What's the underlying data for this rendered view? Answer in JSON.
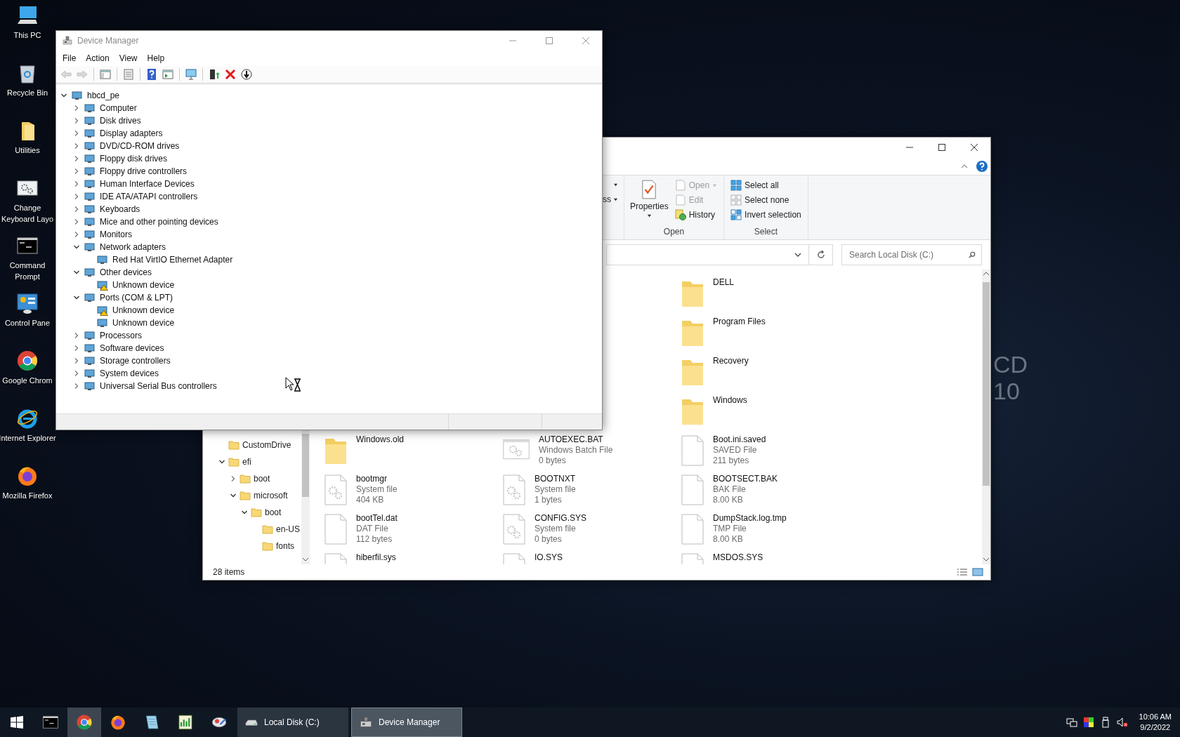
{
  "desktop": {
    "icons": [
      {
        "kind": "pc",
        "lines": [
          "This PC"
        ]
      },
      {
        "kind": "bin",
        "lines": [
          "Recycle Bin"
        ]
      },
      {
        "kind": "folder",
        "lines": [
          "Utilities"
        ]
      },
      {
        "kind": "gears",
        "lines": [
          "Change",
          "Keyboard Layo"
        ]
      },
      {
        "kind": "terminal",
        "lines": [
          "Command",
          "Prompt"
        ]
      },
      {
        "kind": "panel",
        "lines": [
          "Control Pane"
        ]
      },
      {
        "kind": "chrome",
        "lines": [
          "Google Chrom"
        ]
      },
      {
        "kind": "ie",
        "lines": [
          "Internet Explorer"
        ]
      },
      {
        "kind": "firefox",
        "lines": [
          "Mozilla Firefox"
        ]
      }
    ],
    "wallpaper_text": [
      "CD",
      "10"
    ]
  },
  "device_manager": {
    "title": "Device Manager",
    "menu": [
      "File",
      "Action",
      "View",
      "Help"
    ],
    "toolbar": [
      {
        "kind": "back",
        "disabled": true
      },
      {
        "kind": "forward",
        "disabled": true
      },
      {
        "kind": "separator"
      },
      {
        "kind": "tree-view",
        "disabled": false
      },
      {
        "kind": "separator"
      },
      {
        "kind": "properties",
        "disabled": false
      },
      {
        "kind": "separator"
      },
      {
        "kind": "help",
        "disabled": false
      },
      {
        "kind": "action-pane",
        "disabled": false
      },
      {
        "kind": "separator"
      },
      {
        "kind": "scan",
        "disabled": false
      },
      {
        "kind": "separator"
      },
      {
        "kind": "update",
        "disabled": false
      },
      {
        "kind": "uninstall",
        "disabled": false
      },
      {
        "kind": "download",
        "disabled": false
      }
    ],
    "tree": [
      {
        "label": "hbcd_pe",
        "expanded": true,
        "children": [
          {
            "label": "Computer",
            "expanded": false
          },
          {
            "label": "Disk drives",
            "expanded": false
          },
          {
            "label": "Display adapters",
            "expanded": false
          },
          {
            "label": "DVD/CD-ROM drives",
            "expanded": false
          },
          {
            "label": "Floppy disk drives",
            "expanded": false
          },
          {
            "label": "Floppy drive controllers",
            "expanded": false
          },
          {
            "label": "Human Interface Devices",
            "expanded": false
          },
          {
            "label": "IDE ATA/ATAPI controllers",
            "expanded": false
          },
          {
            "label": "Keyboards",
            "expanded": false
          },
          {
            "label": "Mice and other pointing devices",
            "expanded": false
          },
          {
            "label": "Monitors",
            "expanded": false
          },
          {
            "label": "Network adapters",
            "expanded": true,
            "children": [
              {
                "label": "Red Hat VirtIO Ethernet Adapter",
                "problem": false
              }
            ]
          },
          {
            "label": "Other devices",
            "expanded": true,
            "children": [
              {
                "label": "Unknown device",
                "problem": true
              }
            ]
          },
          {
            "label": "Ports (COM & LPT)",
            "expanded": true,
            "children": [
              {
                "label": "Unknown device",
                "problem": true
              },
              {
                "label": "Unknown device",
                "problem": false
              }
            ]
          },
          {
            "label": "Processors",
            "expanded": false
          },
          {
            "label": "Software devices",
            "expanded": false
          },
          {
            "label": "Storage controllers",
            "expanded": false
          },
          {
            "label": "System devices",
            "expanded": false
          },
          {
            "label": "Universal Serial Bus controllers",
            "expanded": false
          }
        ]
      }
    ]
  },
  "explorer": {
    "ribbon": {
      "partial_label": "ss",
      "properties_label": "Properties",
      "open_group": {
        "label": "Open",
        "items": [
          {
            "label": "Open",
            "disabled": true,
            "dropdown": true
          },
          {
            "label": "Edit",
            "disabled": true,
            "dropdown": false
          },
          {
            "label": "History",
            "disabled": false,
            "dropdown": false
          }
        ]
      },
      "select_group": {
        "label": "Select",
        "items": [
          {
            "label": "Select all"
          },
          {
            "label": "Select none"
          },
          {
            "label": "Invert selection"
          }
        ]
      }
    },
    "search": {
      "placeholder": "Search Local Disk (C:)"
    },
    "nav_tree": [
      {
        "label": "CustomDrive"
      },
      {
        "label": "efi",
        "expanded": true,
        "children": [
          {
            "label": "boot",
            "expanded": false
          },
          {
            "label": "microsoft",
            "expanded": true,
            "children": [
              {
                "label": "boot",
                "expanded": true,
                "children": [
                  {
                    "label": "en-US"
                  },
                  {
                    "label": "fonts"
                  }
                ]
              }
            ]
          }
        ]
      }
    ],
    "top_items": [
      {
        "name": "DELL",
        "kind": "folder"
      },
      {
        "name": "Program Files",
        "kind": "folder"
      },
      {
        "name": "Recovery",
        "kind": "folder"
      },
      {
        "name": "Windows",
        "kind": "folder"
      }
    ],
    "rows": [
      [
        {
          "name": "Windows.old",
          "kind": "folder"
        },
        {
          "name": "AUTOEXEC.BAT",
          "kind": "batch",
          "type": "Windows Batch File",
          "size": "0 bytes"
        },
        {
          "name": "Boot.ini.saved",
          "kind": "file",
          "type": "SAVED File",
          "size": "211 bytes"
        }
      ],
      [
        {
          "name": "bootmgr",
          "kind": "system",
          "type": "System file",
          "size": "404 KB"
        },
        {
          "name": "BOOTNXT",
          "kind": "system",
          "type": "System file",
          "size": "1 bytes"
        },
        {
          "name": "BOOTSECT.BAK",
          "kind": "file",
          "type": "BAK File",
          "size": "8.00 KB"
        }
      ],
      [
        {
          "name": "bootTel.dat",
          "kind": "file",
          "type": "DAT File",
          "size": "112 bytes"
        },
        {
          "name": "CONFIG.SYS",
          "kind": "system",
          "type": "System file",
          "size": "0 bytes"
        },
        {
          "name": "DumpStack.log.tmp",
          "kind": "file",
          "type": "TMP File",
          "size": "8.00 KB"
        }
      ],
      [
        {
          "name": "hiberfil.sys",
          "kind": "system"
        },
        {
          "name": "IO.SYS",
          "kind": "system"
        },
        {
          "name": "MSDOS.SYS",
          "kind": "system"
        }
      ]
    ],
    "status": "28 items"
  },
  "taskbar": {
    "apps": [
      {
        "kind": "terminal",
        "selected": false
      },
      {
        "kind": "chrome",
        "selected": true
      },
      {
        "kind": "firefox",
        "selected": false
      },
      {
        "kind": "notes",
        "selected": false
      },
      {
        "kind": "chart",
        "selected": false
      },
      {
        "kind": "tool",
        "selected": false
      }
    ],
    "windows": [
      {
        "label": "Local Disk (C:)",
        "kind": "drive",
        "selected": false
      },
      {
        "label": "Device Manager",
        "kind": "devmgr",
        "selected": true
      }
    ],
    "time": "10:06 AM",
    "date": "9/2/2022"
  }
}
